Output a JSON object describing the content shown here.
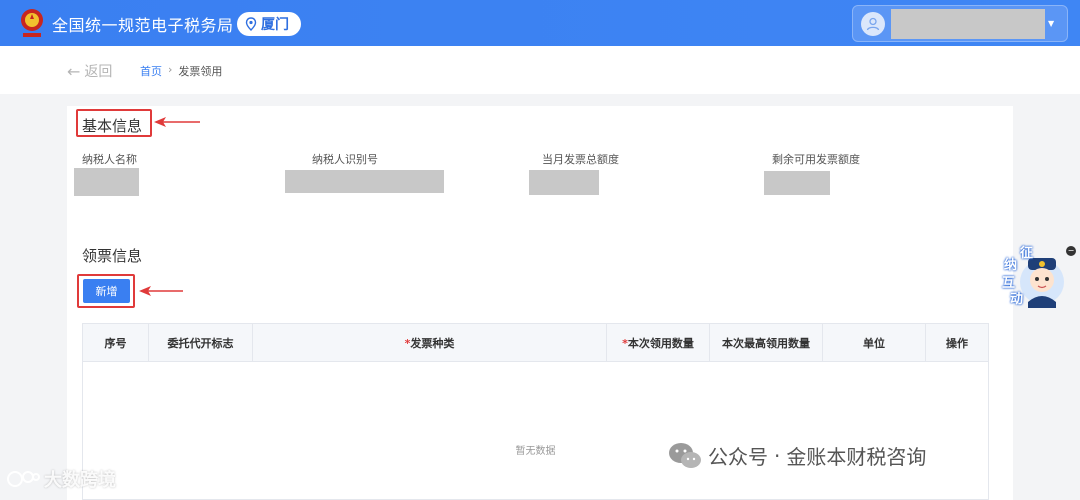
{
  "header": {
    "title": "全国统一规范电子税务局",
    "city": "厦门",
    "logo_icon": "tax-emblem-icon",
    "location_icon": "location-pin-icon",
    "user_icon": "user-avatar-icon",
    "accent_color": "#3a7ff1"
  },
  "breadcrumb": {
    "back_label": "返回",
    "home": "首页",
    "separator": "›",
    "current": "发票领用"
  },
  "basic_info": {
    "title": "基本信息",
    "fields": [
      {
        "label": "纳税人名称"
      },
      {
        "label": "纳税人识别号"
      },
      {
        "label": "当月发票总额度"
      },
      {
        "label": "剩余可用发票额度"
      }
    ]
  },
  "ticket_info": {
    "title": "领票信息",
    "add_button": "新增"
  },
  "table": {
    "columns": [
      {
        "label": "序号",
        "required": false
      },
      {
        "label": "委托代开标志",
        "required": false
      },
      {
        "label": "发票种类",
        "required": true
      },
      {
        "label": "本次领用数量",
        "required": true
      },
      {
        "label": "本次最高领用数量",
        "required": false
      },
      {
        "label": "单位",
        "required": false
      },
      {
        "label": "操作",
        "required": false
      }
    ],
    "required_mark": "*",
    "empty_text": "暂无数据"
  },
  "float_widget": {
    "chars": [
      "征",
      "纳",
      "互",
      "动"
    ],
    "close": "−"
  },
  "watermarks": {
    "left": "大数跨境",
    "right_prefix": "公众号",
    "right_dot": "·",
    "right_name": "金账本财税咨询"
  }
}
